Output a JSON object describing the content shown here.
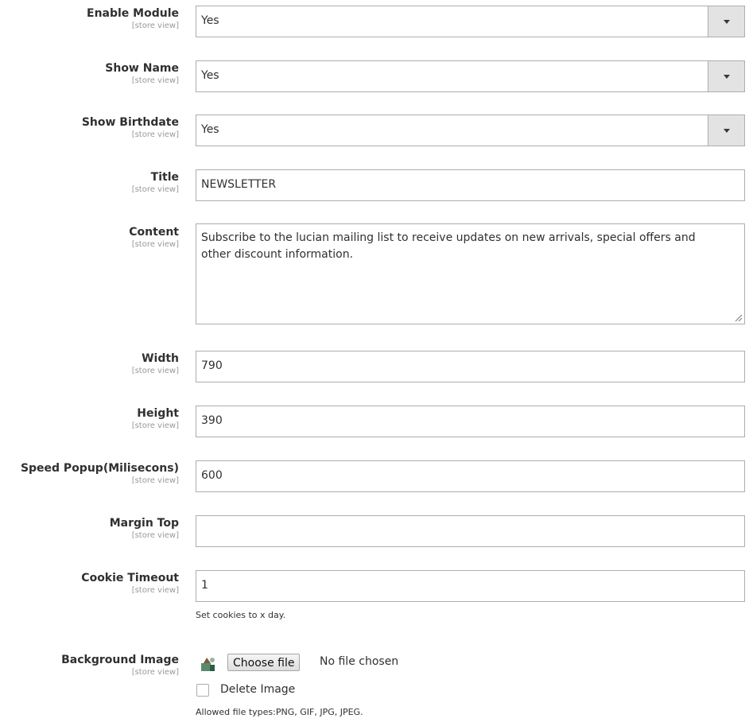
{
  "scope_label": "[store view]",
  "fields": {
    "enable_module": {
      "label": "Enable Module",
      "value": "Yes"
    },
    "show_name": {
      "label": "Show Name",
      "value": "Yes"
    },
    "show_birthdate": {
      "label": "Show Birthdate",
      "value": "Yes"
    },
    "title": {
      "label": "Title",
      "value": "NEWSLETTER"
    },
    "content": {
      "label": "Content",
      "value": "Subscribe to the lucian mailing list to receive updates on new arrivals, special offers and other discount information."
    },
    "width": {
      "label": "Width",
      "value": "790"
    },
    "height": {
      "label": "Height",
      "value": "390"
    },
    "speed_popup": {
      "label": "Speed Popup(Milisecons)",
      "value": "600"
    },
    "margin_top": {
      "label": "Margin Top",
      "value": ""
    },
    "cookie_timeout": {
      "label": "Cookie Timeout",
      "value": "1",
      "note": "Set cookies to x day."
    },
    "background_image": {
      "label": "Background Image",
      "choose_file_label": "Choose file",
      "no_file_text": "No file chosen",
      "delete_label": "Delete Image",
      "note": "Allowed file types:PNG, GIF, JPG, JPEG."
    }
  },
  "icons": {
    "image_placeholder": "image-icon",
    "dropdown": "chevron-down-icon"
  }
}
